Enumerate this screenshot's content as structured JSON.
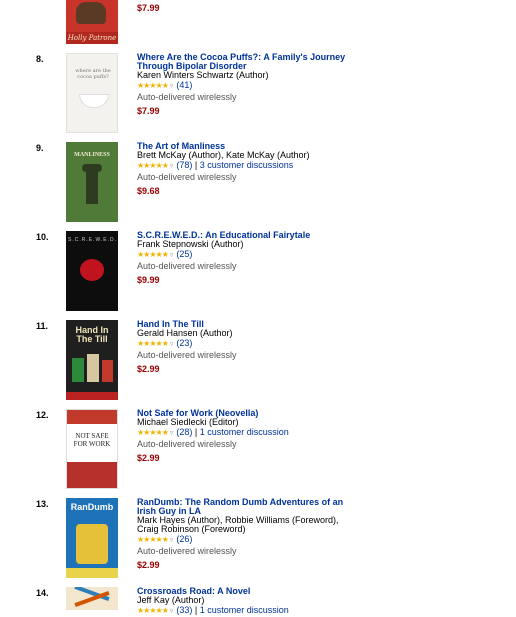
{
  "colors": {
    "link": "#003399",
    "price": "#990000",
    "star": "#f0b400"
  },
  "entries": [
    {
      "rank": "",
      "title": "",
      "authors": "",
      "stars": "",
      "reviews": "",
      "discussions": "",
      "auto": "",
      "price": "$7.99",
      "cover_text": "Holly Patrone"
    },
    {
      "rank": "8.",
      "title": "Where Are the Cocoa Puffs?: A Family's Journey Through Bipolar Disorder",
      "authors": "Karen Winters Schwartz (Author)",
      "stars": "★★★★★",
      "reviews": "(41)",
      "discussions": "",
      "auto": "Auto-delivered wirelessly",
      "price": "$7.99",
      "cover_text": "where are the cocoa puffs?"
    },
    {
      "rank": "9.",
      "title": "The Art of Manliness",
      "authors": "Brett McKay (Author), Kate McKay (Author)",
      "stars": "★★★★★",
      "reviews": "(78)",
      "discussions": "3 customer discussions",
      "auto": "Auto-delivered wirelessly",
      "price": "$9.68",
      "cover_text": "MANLINESS"
    },
    {
      "rank": "10.",
      "title": "S.C.R.E.W.E.D.: An Educational Fairytale",
      "authors": "Frank Stepnowski (Author)",
      "stars": "★★★★★",
      "reviews": "(25)",
      "discussions": "",
      "auto": "Auto-delivered wirelessly",
      "price": "$9.99",
      "cover_text": "S.C.R.E.W.E.D."
    },
    {
      "rank": "11.",
      "title": "Hand In The Till",
      "authors": "Gerald Hansen (Author)",
      "stars": "★★★★★",
      "reviews": "(23)",
      "discussions": "",
      "auto": "Auto-delivered wirelessly",
      "price": "$2.99",
      "cover_text": "Hand In The Till"
    },
    {
      "rank": "12.",
      "title": "Not Safe for Work (Neovella)",
      "authors": "Michael Siedlecki (Editor)",
      "stars": "★★★★★",
      "reviews": "(28)",
      "discussions": "1 customer discussion",
      "auto": "Auto-delivered wirelessly",
      "price": "$2.99",
      "cover_text": "NOT SAFE FOR WORK"
    },
    {
      "rank": "13.",
      "title": "RanDumb: The Random Dumb Adventures of an Irish Guy in LA",
      "authors": "Mark Hayes (Author), Robbie Williams (Foreword), Craig Robinson (Foreword)",
      "stars": "★★★★★",
      "reviews": "(26)",
      "discussions": "",
      "auto": "Auto-delivered wirelessly",
      "price": "$2.99",
      "cover_text": "RanDumb"
    },
    {
      "rank": "14.",
      "title": "Crossroads Road: A Novel",
      "authors": "Jeff Kay (Author)",
      "stars": "★★★★★",
      "reviews": "(33)",
      "discussions": "1 customer discussion",
      "auto": "",
      "price": "",
      "cover_text": ""
    }
  ]
}
